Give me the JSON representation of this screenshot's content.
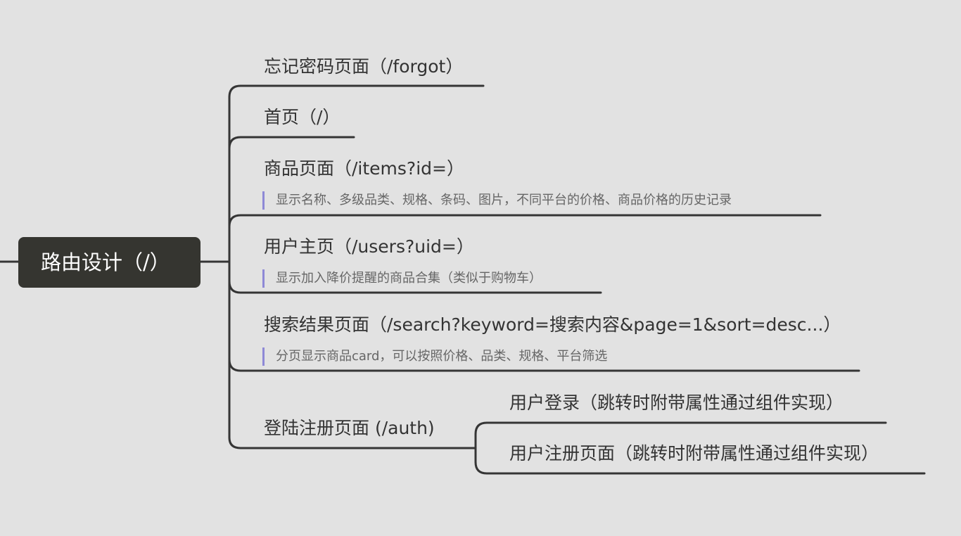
{
  "colors": {
    "background": "#e2e2e2",
    "root_fill": "#353530",
    "branch_line": "#353535",
    "note_bar": "#8e89d6"
  },
  "mindmap": {
    "root": "路由设计（/）",
    "branches": [
      {
        "title": "忘记密码页面（/forgot）"
      },
      {
        "title": "首页（/）"
      },
      {
        "title": "商品页面（/items?id=）",
        "note": "显示名称、多级品类、规格、条码、图片，不同平台的价格、商品价格的历史记录"
      },
      {
        "title": "用户主页（/users?uid=）",
        "note": "显示加入降价提醒的商品合集（类似于购物车）"
      },
      {
        "title": "搜索结果页面（/search?keyword=搜索内容&page=1&sort=desc...）",
        "note": "分页显示商品card，可以按照价格、品类、规格、平台筛选"
      },
      {
        "title": "登陆注册页面 (/auth)",
        "children": [
          {
            "title": "用户登录（跳转时附带属性通过组件实现）"
          },
          {
            "title": "用户注册页面（跳转时附带属性通过组件实现）"
          }
        ]
      }
    ]
  }
}
